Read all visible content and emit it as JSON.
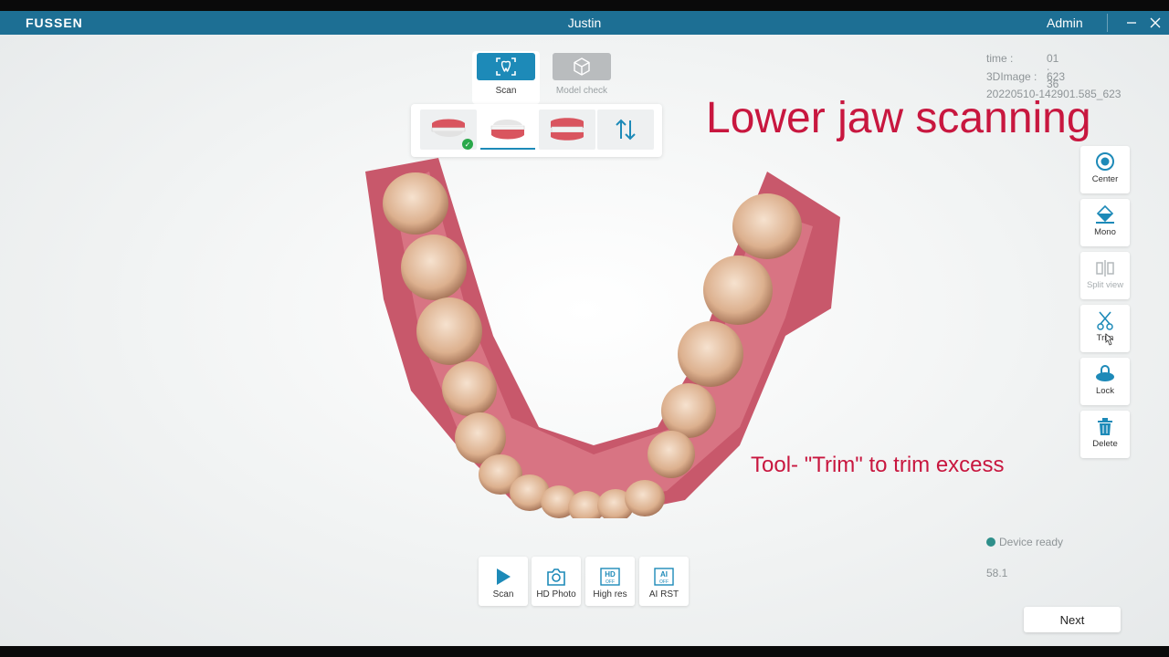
{
  "app": {
    "brand": "FUSSEN",
    "patient_name": "Justin",
    "user": "Admin",
    "title_bar_color": "#1d6f94"
  },
  "modes": [
    {
      "label": "Scan",
      "icon": "scan-tooth-icon",
      "active": true
    },
    {
      "label": "Model check",
      "icon": "cube-icon",
      "active": false
    }
  ],
  "jaw_selector": {
    "items": [
      {
        "icon": "upper-jaw-icon",
        "state": "completed"
      },
      {
        "icon": "lower-jaw-icon",
        "state": "active"
      },
      {
        "icon": "bite-icon",
        "state": "idle"
      },
      {
        "icon": "swap-arrows-icon",
        "state": "idle"
      }
    ]
  },
  "info": {
    "time_label": "time :",
    "time_value": "01 : 36",
    "image_label": "3DImage :",
    "image_value": "623",
    "file_id": "20220510-142901.585_623"
  },
  "overlay": {
    "heading": "Lower jaw scanning",
    "note": "Tool- \"Trim\" to trim excess",
    "color": "#c8173f"
  },
  "tools": [
    {
      "label": "Center",
      "icon": "target-icon",
      "enabled": true
    },
    {
      "label": "Mono",
      "icon": "paint-bucket-icon",
      "enabled": true
    },
    {
      "label": "Split view",
      "icon": "split-view-icon",
      "enabled": false
    },
    {
      "label": "Trim",
      "icon": "scissors-icon",
      "enabled": true
    },
    {
      "label": "Lock",
      "icon": "lock-icon",
      "enabled": true
    },
    {
      "label": "Delete",
      "icon": "trash-icon",
      "enabled": true
    }
  ],
  "bottom_toolbar": [
    {
      "label": "Scan",
      "icon": "play-icon"
    },
    {
      "label": "HD Photo",
      "icon": "camera-icon"
    },
    {
      "label": "High res",
      "icon": "hd-off-icon"
    },
    {
      "label": "AI RST",
      "icon": "ai-off-icon"
    }
  ],
  "status": {
    "text": "Device ready",
    "dot_color": "#2e8f8a",
    "frame_rate": "58.1"
  },
  "next_label": "Next",
  "accent_color": "#1d8ab8"
}
